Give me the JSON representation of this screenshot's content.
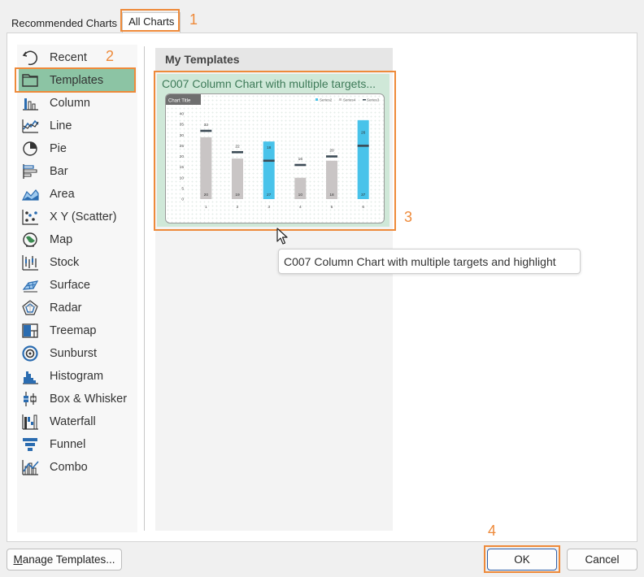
{
  "tabs": [
    {
      "label": "Recommended Charts"
    },
    {
      "label": "All Charts"
    }
  ],
  "annotations": [
    "1",
    "2",
    "3",
    "4"
  ],
  "nav": {
    "items": [
      {
        "label": "Recent",
        "icon": "recent-icon"
      },
      {
        "label": "Templates",
        "icon": "folder-icon",
        "selected": true
      },
      {
        "label": "Column",
        "icon": "column-chart-icon"
      },
      {
        "label": "Line",
        "icon": "line-chart-icon"
      },
      {
        "label": "Pie",
        "icon": "pie-chart-icon"
      },
      {
        "label": "Bar",
        "icon": "bar-chart-icon"
      },
      {
        "label": "Area",
        "icon": "area-chart-icon"
      },
      {
        "label": "X Y (Scatter)",
        "icon": "scatter-chart-icon"
      },
      {
        "label": "Map",
        "icon": "map-chart-icon"
      },
      {
        "label": "Stock",
        "icon": "stock-chart-icon"
      },
      {
        "label": "Surface",
        "icon": "surface-chart-icon"
      },
      {
        "label": "Radar",
        "icon": "radar-chart-icon"
      },
      {
        "label": "Treemap",
        "icon": "treemap-chart-icon"
      },
      {
        "label": "Sunburst",
        "icon": "sunburst-chart-icon"
      },
      {
        "label": "Histogram",
        "icon": "histogram-chart-icon"
      },
      {
        "label": "Box & Whisker",
        "icon": "box-whisker-chart-icon"
      },
      {
        "label": "Waterfall",
        "icon": "waterfall-chart-icon"
      },
      {
        "label": "Funnel",
        "icon": "funnel-chart-icon"
      },
      {
        "label": "Combo",
        "icon": "combo-chart-icon"
      }
    ]
  },
  "templates": {
    "section_title": "My Templates",
    "card_title": "C007 Column Chart with multiple targets...",
    "tooltip": "C007 Column Chart with multiple targets and highlight"
  },
  "buttons": {
    "manage_prefix": "M",
    "manage_rest": "anage Templates...",
    "ok": "OK",
    "cancel": "Cancel"
  },
  "colors": {
    "highlight": "#ee8a3a",
    "selected": "#8cc4a4",
    "highlight_bar": "#49c3ea",
    "grey_bar": "#c9c5c5",
    "target": "#3b4a55"
  },
  "chart_data": {
    "type": "bar",
    "title": "Chart Title",
    "categories": [
      "1",
      "2",
      "3",
      "4",
      "5",
      "6"
    ],
    "series": [
      {
        "name": "Series2",
        "values": [
          0,
          0,
          27,
          0,
          0,
          37
        ]
      },
      {
        "name": "Series4",
        "values": [
          29,
          19,
          0,
          10,
          18,
          0
        ]
      },
      {
        "name": "Series3",
        "values": [
          32,
          22,
          18,
          16,
          20,
          25
        ]
      }
    ],
    "bar_labels": [
      "20",
      "19",
      "27",
      "10",
      "18",
      "37"
    ],
    "target_labels": [
      "32",
      "22",
      "18",
      "16",
      "20",
      "26"
    ],
    "yticks": [
      "0",
      "5",
      "10",
      "15",
      "20",
      "25",
      "30",
      "35",
      "40"
    ],
    "ylim": [
      0,
      40
    ],
    "legend": "top-right"
  }
}
